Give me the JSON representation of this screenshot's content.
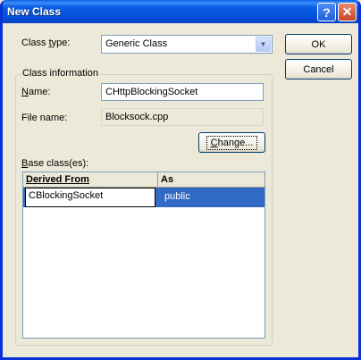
{
  "window": {
    "title": "New Class",
    "help_glyph": "?",
    "close_glyph": "✕"
  },
  "class_type": {
    "label_pre": "Class ",
    "label_key": "t",
    "label_post": "ype:",
    "value": "Generic Class",
    "arrow_glyph": "▼"
  },
  "buttons": {
    "ok": "OK",
    "cancel": "Cancel",
    "change_key": "C",
    "change_post": "hange..."
  },
  "class_information": {
    "group_title": "Class information",
    "name_key": "N",
    "name_post": "ame:",
    "name_value": "CHttpBlockingSocket",
    "file_label": "File name:",
    "file_value": "Blocksock.cpp"
  },
  "base_classes": {
    "label_key": "B",
    "label_post": "ase class(es):",
    "columns": [
      "Derived From",
      "As"
    ],
    "rows": [
      {
        "derived_from": "CBlockingSocket",
        "as": "public"
      }
    ]
  },
  "colors": {
    "title_bar": "#0a5fe3",
    "selection": "#316ac5",
    "face": "#ece9d8"
  }
}
